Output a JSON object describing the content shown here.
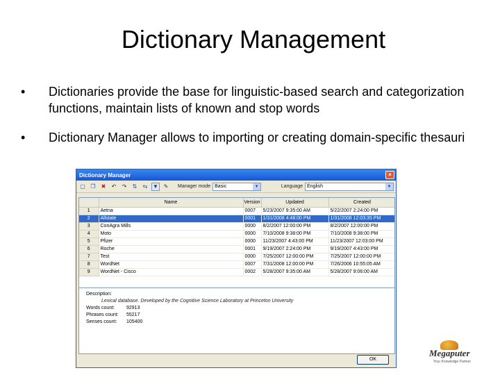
{
  "slide": {
    "title": "Dictionary Management",
    "bullets": [
      "Dictionaries provide the base for linguistic-based search and categorization functions, maintain lists of known and stop words",
      "Dictionary Manager allows to importing or creating domain-specific thesauri"
    ]
  },
  "dialog": {
    "title": "Dictionary Manager",
    "close_label": "×",
    "toolbar": {
      "manager_mode_label": "Manager mode",
      "manager_mode_value": "Basic",
      "language_label": "Language",
      "language_value": "English"
    },
    "table": {
      "columns": [
        "",
        "Name",
        "Version",
        "Updated",
        "Created"
      ],
      "rows": [
        {
          "num": "1",
          "name": "Aetna",
          "version": "0007",
          "updated": "5/23/2007 9:35:00 AM",
          "created": "5/22/2007 2:24:00 PM"
        },
        {
          "num": "2",
          "name": "Allstate",
          "version": "0001",
          "updated": "1/31/2008 4:48:00 PM",
          "created": "1/31/2008 12:03:35 PM"
        },
        {
          "num": "3",
          "name": "ConAgra Mills",
          "version": "0000",
          "updated": "8/2/2007 12:00:00 PM",
          "created": "8/2/2007 12:00:00 PM"
        },
        {
          "num": "4",
          "name": "Moto",
          "version": "0000",
          "updated": "7/10/2008 9:38:00 PM",
          "created": "7/10/2008 9:38:00 PM"
        },
        {
          "num": "5",
          "name": "Pfizer",
          "version": "0000",
          "updated": "11/23/2007 4:43:00 PM",
          "created": "11/23/2007 12:03:00 PM"
        },
        {
          "num": "6",
          "name": "Roche",
          "version": "0001",
          "updated": "9/19/2007 2:24:00 PM",
          "created": "9/19/2007 4:43:00 PM"
        },
        {
          "num": "7",
          "name": "Test",
          "version": "0000",
          "updated": "7/25/2007 12:00:00 PM",
          "created": "7/25/2007 12:00:00 PM"
        },
        {
          "num": "8",
          "name": "WordNet",
          "version": "0007",
          "updated": "7/31/2008 12:00:00 PM",
          "created": "7/26/2006 10:55:05 AM"
        },
        {
          "num": "9",
          "name": "WordNet - Cisco",
          "version": "0002",
          "updated": "5/28/2007 9:35:00 AM",
          "created": "5/28/2007 9:06:00 AM"
        }
      ],
      "selected_row": 1
    },
    "details": {
      "description_label": "Description:",
      "description_text": "Lexical database. Developed by the Cognitive Science Laboratory at Princeton University",
      "words_label": "Words count:",
      "words_value": "92913",
      "phrases_label": "Phrases count:",
      "phrases_value": "55217",
      "senses_label": "Senses count:",
      "senses_value": "105400"
    },
    "ok_label": "OK"
  },
  "logo": {
    "name": "Megaputer",
    "tagline": "Your Knowledge Partner"
  }
}
